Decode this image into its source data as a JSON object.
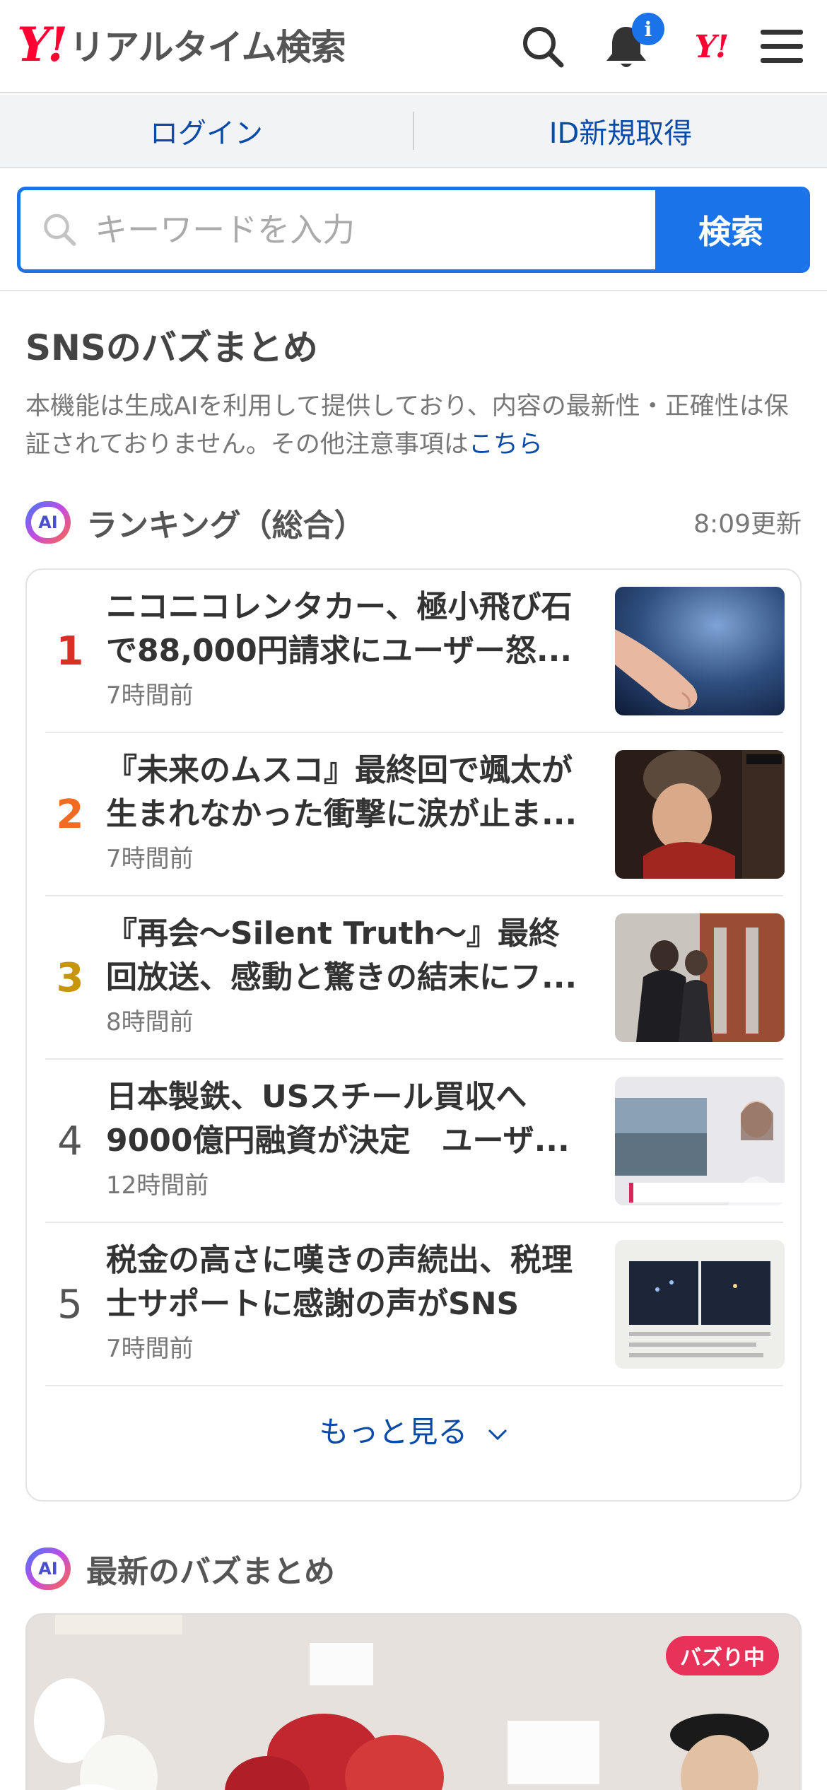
{
  "header": {
    "logo_mark": "Y!",
    "logo_text": "リアルタイム検索",
    "notification_badge": "i",
    "yahoo_mark": "Y!"
  },
  "auth": {
    "login": "ログイン",
    "register": "ID新規取得"
  },
  "search": {
    "placeholder": "キーワードを入力",
    "button": "検索"
  },
  "buzz_summary": {
    "title": "SNSのバズまとめ",
    "notice": "本機能は生成AIを利用して提供しており、内容の最新性・正確性は保証されておりません。その他注意事項は",
    "notice_link": "こちら"
  },
  "ranking": {
    "ai_badge": "AI",
    "title": "ランキング（総合）",
    "updated": "8:09更新",
    "items": [
      {
        "rank": "1",
        "title": "ニコニコレンタカー、極小飛び石で88,000円請求にユーザー怒...",
        "time": "7時間前"
      },
      {
        "rank": "2",
        "title": "『未来のムスコ』最終回で颯太が生まれなかった衝撃に涙が止ま...",
        "time": "7時間前"
      },
      {
        "rank": "3",
        "title": "『再会〜Silent Truth〜』最終回放送、感動と驚きの結末にフ...",
        "time": "8時間前"
      },
      {
        "rank": "4",
        "title": "日本製鉄、USスチール買収へ9000億円融資が決定　ユーザ...",
        "time": "12時間前"
      },
      {
        "rank": "5",
        "title": "税金の高さに嘆きの声続出、税理士サポートに感謝の声がSNS上...",
        "time": "7時間前"
      }
    ],
    "more": "もっと見る"
  },
  "latest": {
    "ai_badge": "AI",
    "title": "最新のバズまとめ",
    "badge": "バズり中"
  },
  "colors": {
    "brand_red": "#ff0033",
    "accent_blue": "#1a73e8",
    "link_blue": "#0a4aa8",
    "rank1": "#d93025",
    "rank2": "#f26b21",
    "rank3": "#c8960c",
    "rank_other": "#555555"
  }
}
